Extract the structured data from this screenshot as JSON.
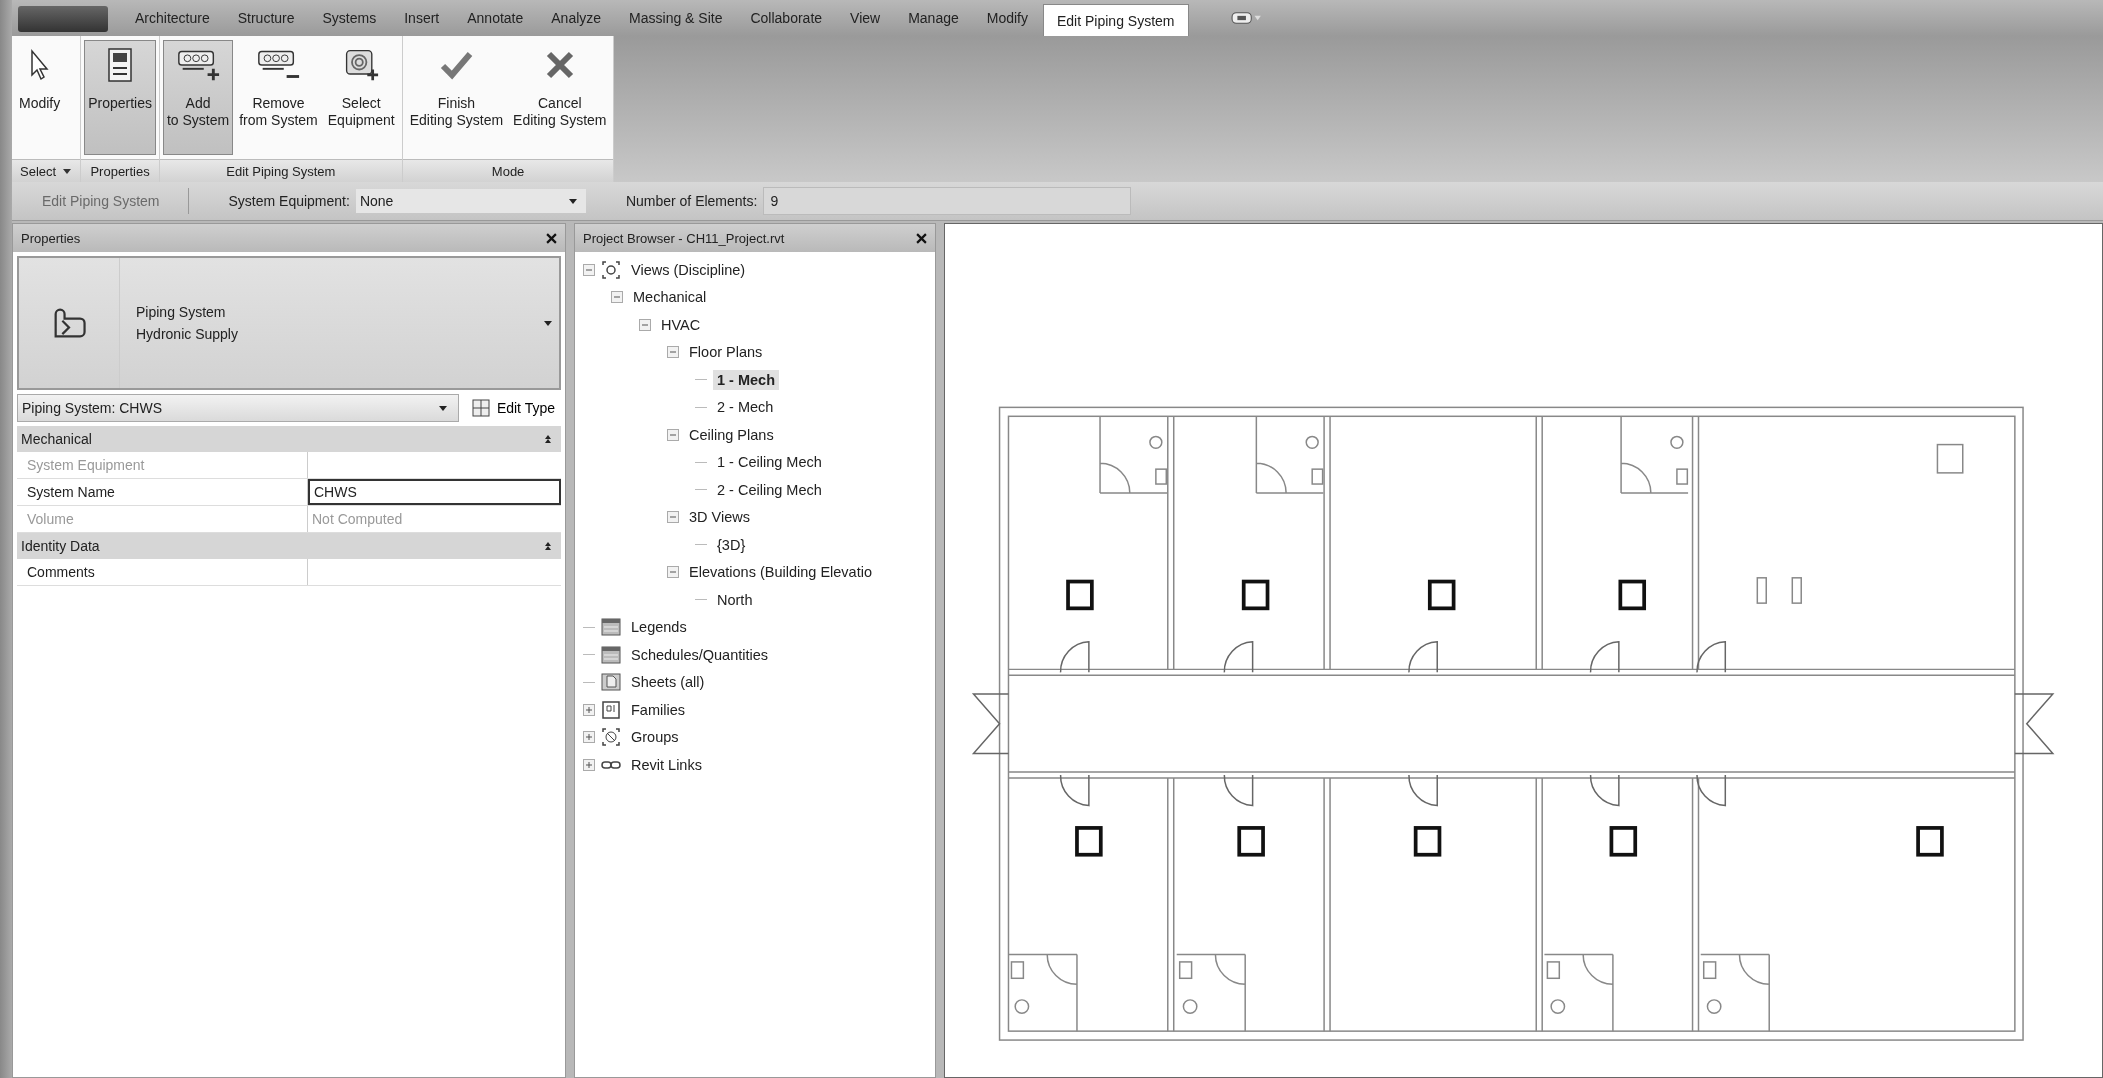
{
  "ribbon": {
    "tabs": [
      {
        "label": "Architecture",
        "selected": false
      },
      {
        "label": "Structure",
        "selected": false
      },
      {
        "label": "Systems",
        "selected": false
      },
      {
        "label": "Insert",
        "selected": false
      },
      {
        "label": "Annotate",
        "selected": false
      },
      {
        "label": "Analyze",
        "selected": false
      },
      {
        "label": "Massing & Site",
        "selected": false
      },
      {
        "label": "Collaborate",
        "selected": false
      },
      {
        "label": "View",
        "selected": false
      },
      {
        "label": "Manage",
        "selected": false
      },
      {
        "label": "Modify",
        "selected": false
      },
      {
        "label": "Edit Piping System",
        "selected": true
      }
    ],
    "groups": [
      {
        "label": "Select",
        "dropdown": true,
        "buttons": [
          {
            "kind": "modify",
            "lines": [
              "Modify"
            ],
            "selected": false
          }
        ]
      },
      {
        "label": "Properties",
        "dropdown": false,
        "buttons": [
          {
            "kind": "properties",
            "lines": [
              "Properties"
            ],
            "selected": true
          }
        ]
      },
      {
        "label": "Edit Piping System",
        "dropdown": false,
        "buttons": [
          {
            "kind": "add",
            "lines": [
              "Add",
              "to System"
            ],
            "selected": true
          },
          {
            "kind": "remove",
            "lines": [
              "Remove",
              "from System"
            ],
            "selected": false
          },
          {
            "kind": "equipment",
            "lines": [
              "Select",
              "Equipment"
            ],
            "selected": false
          }
        ]
      },
      {
        "label": "Mode",
        "dropdown": false,
        "buttons": [
          {
            "kind": "finish",
            "lines": [
              "Finish",
              "Editing System"
            ],
            "selected": false
          },
          {
            "kind": "cancel",
            "lines": [
              "Cancel",
              "Editing System"
            ],
            "selected": false
          }
        ]
      }
    ]
  },
  "options_bar": {
    "mode_label": "Edit Piping System",
    "mode_disabled": true,
    "system_equipment": {
      "label": "System Equipment:",
      "value": "None"
    },
    "number_of_elements": {
      "label": "Number of Elements:",
      "value": "9"
    }
  },
  "properties": {
    "title": "Properties",
    "type_lines": [
      "Piping System",
      "Hydronic Supply"
    ],
    "type_selector": "Piping System: CHWS",
    "edit_type": "Edit Type",
    "groups": [
      {
        "name": "Mechanical",
        "expanded": true,
        "rows": [
          {
            "name": "System Equipment",
            "disabled": true,
            "editing": false
          },
          {
            "name": "System Name",
            "value": "CHWS",
            "disabled": false,
            "editing": true
          },
          {
            "name": "Volume",
            "value": "Not Computed",
            "disabled": true,
            "editing": false
          }
        ]
      },
      {
        "name": "Identity Data",
        "expanded": true,
        "rows": [
          {
            "name": "Comments",
            "disabled": false,
            "editing": false
          }
        ]
      }
    ]
  },
  "project_browser": {
    "title": "Project Browser - CH11_Project.rvt",
    "tree": [
      {
        "label": "Views (Discipline)",
        "kind": "views",
        "expanded": true,
        "selected": false,
        "children": [
          {
            "label": "Mechanical",
            "expanded": true,
            "selected": false,
            "children": [
              {
                "label": "HVAC",
                "expanded": true,
                "selected": false,
                "children": [
                  {
                    "label": "Floor Plans",
                    "expanded": true,
                    "selected": false,
                    "children": [
                      {
                        "label": "1 - Mech",
                        "selected": true
                      },
                      {
                        "label": "2 - Mech",
                        "selected": false
                      }
                    ]
                  },
                  {
                    "label": "Ceiling Plans",
                    "expanded": true,
                    "selected": false,
                    "children": [
                      {
                        "label": "1 - Ceiling Mech",
                        "selected": false
                      },
                      {
                        "label": "2 - Ceiling Mech",
                        "selected": false
                      }
                    ]
                  },
                  {
                    "label": "3D Views",
                    "expanded": true,
                    "selected": false,
                    "children": [
                      {
                        "label": "{3D}",
                        "selected": false
                      }
                    ]
                  },
                  {
                    "label": "Elevations (Building Elevatio",
                    "expanded": true,
                    "selected": false,
                    "children": [
                      {
                        "label": "North",
                        "selected": false
                      }
                    ]
                  }
                ]
              }
            ]
          }
        ]
      },
      {
        "label": "Legends",
        "kind": "legends",
        "selected": false
      },
      {
        "label": "Schedules/Quantities",
        "kind": "schedules",
        "selected": false
      },
      {
        "label": "Sheets (all)",
        "kind": "sheets",
        "selected": false
      },
      {
        "label": "Families",
        "kind": "families",
        "expanded": false,
        "selected": false
      },
      {
        "label": "Groups",
        "kind": "groups",
        "expanded": false,
        "selected": false
      },
      {
        "label": "Revit Links",
        "kind": "links",
        "expanded": false,
        "selected": false
      }
    ]
  }
}
